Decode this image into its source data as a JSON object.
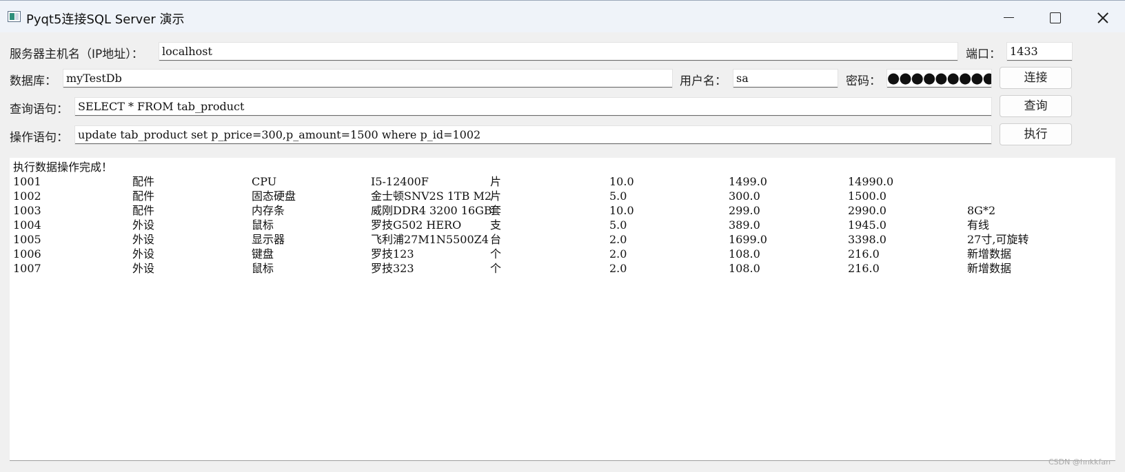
{
  "window": {
    "title": "Pyqt5连接SQL Server 演示"
  },
  "form": {
    "host_label": "服务器主机名（IP地址）：",
    "host_value": "localhost",
    "port_label": "端口：",
    "port_value": "1433",
    "db_label": "数据库：",
    "db_value": "myTestDb",
    "user_label": "用户名：",
    "user_value": "sa",
    "pwd_label": "密码：",
    "pwd_value": "●●●●●●●●●",
    "connect_label": "连接",
    "query_label": "查询语句：",
    "query_value": "SELECT * FROM tab_product",
    "query_button": "查询",
    "exec_label": "操作语句：",
    "exec_value": "update tab_product set p_price=300,p_amount=1500 where p_id=1002",
    "exec_button": "执行"
  },
  "output": {
    "status": "执行数据操作完成！",
    "rows": [
      [
        "1001",
        "配件",
        "CPU",
        "I5-12400F",
        "片",
        "10.0",
        "1499.0",
        "14990.0",
        ""
      ],
      [
        "1002",
        "配件",
        "固态硬盘",
        "金士顿SNV2S 1TB M2",
        "片",
        "5.0",
        "300.0",
        "1500.0",
        ""
      ],
      [
        "1003",
        "配件",
        "内存条",
        "威刚DDR4 3200 16GB",
        "套",
        "10.0",
        "299.0",
        "2990.0",
        "8G*2"
      ],
      [
        "1004",
        "外设",
        "鼠标",
        "罗技G502 HERO",
        "支",
        "5.0",
        "389.0",
        "1945.0",
        "有线"
      ],
      [
        "1005",
        "外设",
        "显示器",
        "飞利浦27M1N5500Z4",
        "台",
        "2.0",
        "1699.0",
        "3398.0",
        "27寸,可旋转"
      ],
      [
        "1006",
        "外设",
        "键盘",
        "罗技123",
        "个",
        "2.0",
        "108.0",
        "216.0",
        "新增数据"
      ],
      [
        "1007",
        "外设",
        "鼠标",
        "罗技323",
        "个",
        "2.0",
        "108.0",
        "216.0",
        "新增数据"
      ]
    ]
  },
  "watermark": "CSDN @hnkkfan"
}
